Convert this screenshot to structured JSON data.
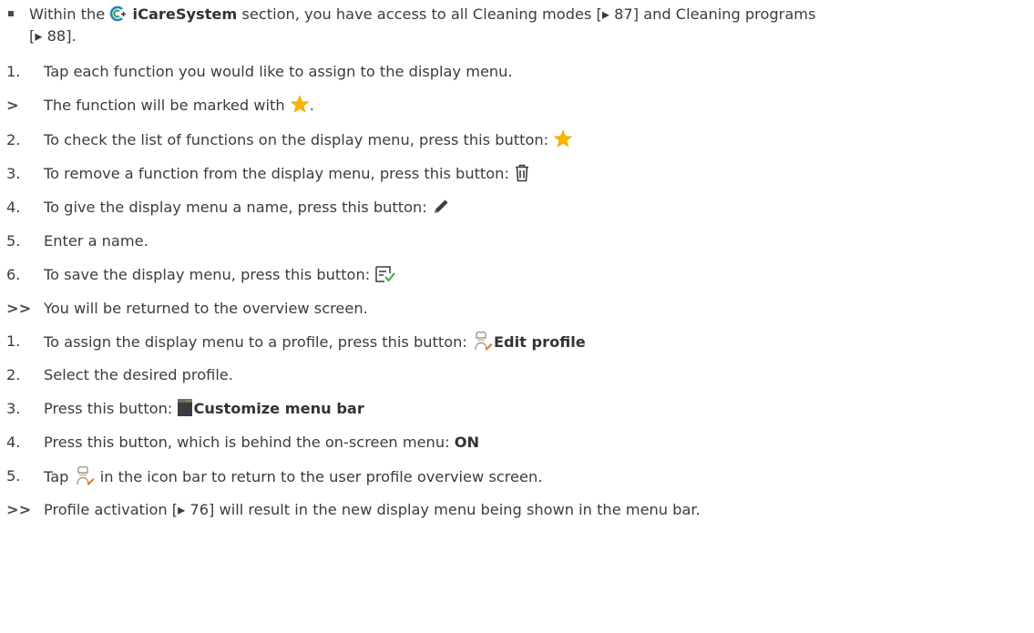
{
  "bullet": {
    "pre": "Within the ",
    "section_name": "iCareSystem",
    "mid": " section, you have access to all Cleaning modes [",
    "ref1": "87",
    "mid2": "] and Cleaning programs",
    "cont_pre": "[",
    "ref2": "88",
    "cont_post": "]."
  },
  "list1": [
    {
      "num": "1.",
      "text": "Tap each function you would like to assign to the display menu."
    },
    {
      "marker": ">",
      "text": "The function will be marked with ",
      "icon": "star-icon",
      "post": "."
    },
    {
      "num": "2.",
      "text": "To check the list of functions on the display menu, press this button: ",
      "icon": "star-icon"
    },
    {
      "num": "3.",
      "text": "To remove a function from the display menu, press this button: ",
      "icon": "trash-icon"
    },
    {
      "num": "4.",
      "text": "To give the display menu a name, press this button: ",
      "icon": "pencil-icon"
    },
    {
      "num": "5.",
      "text": "Enter a name."
    },
    {
      "num": "6.",
      "text": "To save the display menu, press this button: ",
      "icon": "save-list-icon"
    },
    {
      "marker": ">>",
      "text": "You will be returned to the overview screen."
    }
  ],
  "list2": [
    {
      "num": "1.",
      "text": "To assign the display menu to a profile, press this button: ",
      "icon": "chef-edit-icon",
      "bold": "Edit profile"
    },
    {
      "num": "2.",
      "text": "Select the desired profile."
    },
    {
      "num": "3.",
      "text": "Press this button: ",
      "icon": "menu-bar-icon",
      "bold": "Customize menu bar"
    },
    {
      "num": "4.",
      "text": "Press this button, which is behind the on-screen menu: ",
      "bold": "ON"
    },
    {
      "num": "5.",
      "text_pre": "Tap ",
      "icon": "chef-edit-icon",
      "text": " in the icon bar to return to the user profile overview screen."
    },
    {
      "marker": ">>",
      "text_pre": "Profile activation [",
      "ref": "76",
      "text": "] will result in the new display menu being shown in the menu bar."
    }
  ],
  "colors": {
    "star": "#f7b500",
    "icare_blue": "#2a7fc1",
    "icare_green": "#3aa845",
    "pencil_orange": "#e07a1f"
  }
}
